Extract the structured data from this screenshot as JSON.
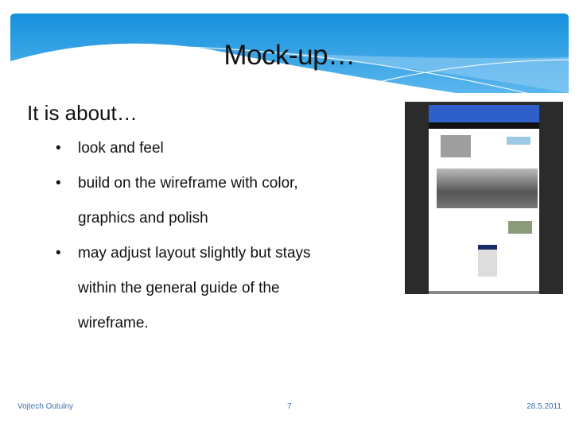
{
  "slide": {
    "title": "Mock-up…",
    "lead": "It is about…",
    "bullets": [
      {
        "line1": "look and feel"
      },
      {
        "line1": "build on the wireframe with color,",
        "line2": "graphics and polish"
      },
      {
        "line1": "may adjust layout slightly but stays",
        "line2": "within the general guide of the",
        "line3": "wireframe."
      }
    ],
    "image": {
      "icon": "website-mockup-screenshot-image"
    }
  },
  "footer": {
    "author": "Vojtech Outulny",
    "page": "7",
    "date": "28.5.2011"
  },
  "colors": {
    "banner_top": "#1591dc",
    "banner_light": "#8fcdf3",
    "footer_text": "#3a6fb0"
  }
}
